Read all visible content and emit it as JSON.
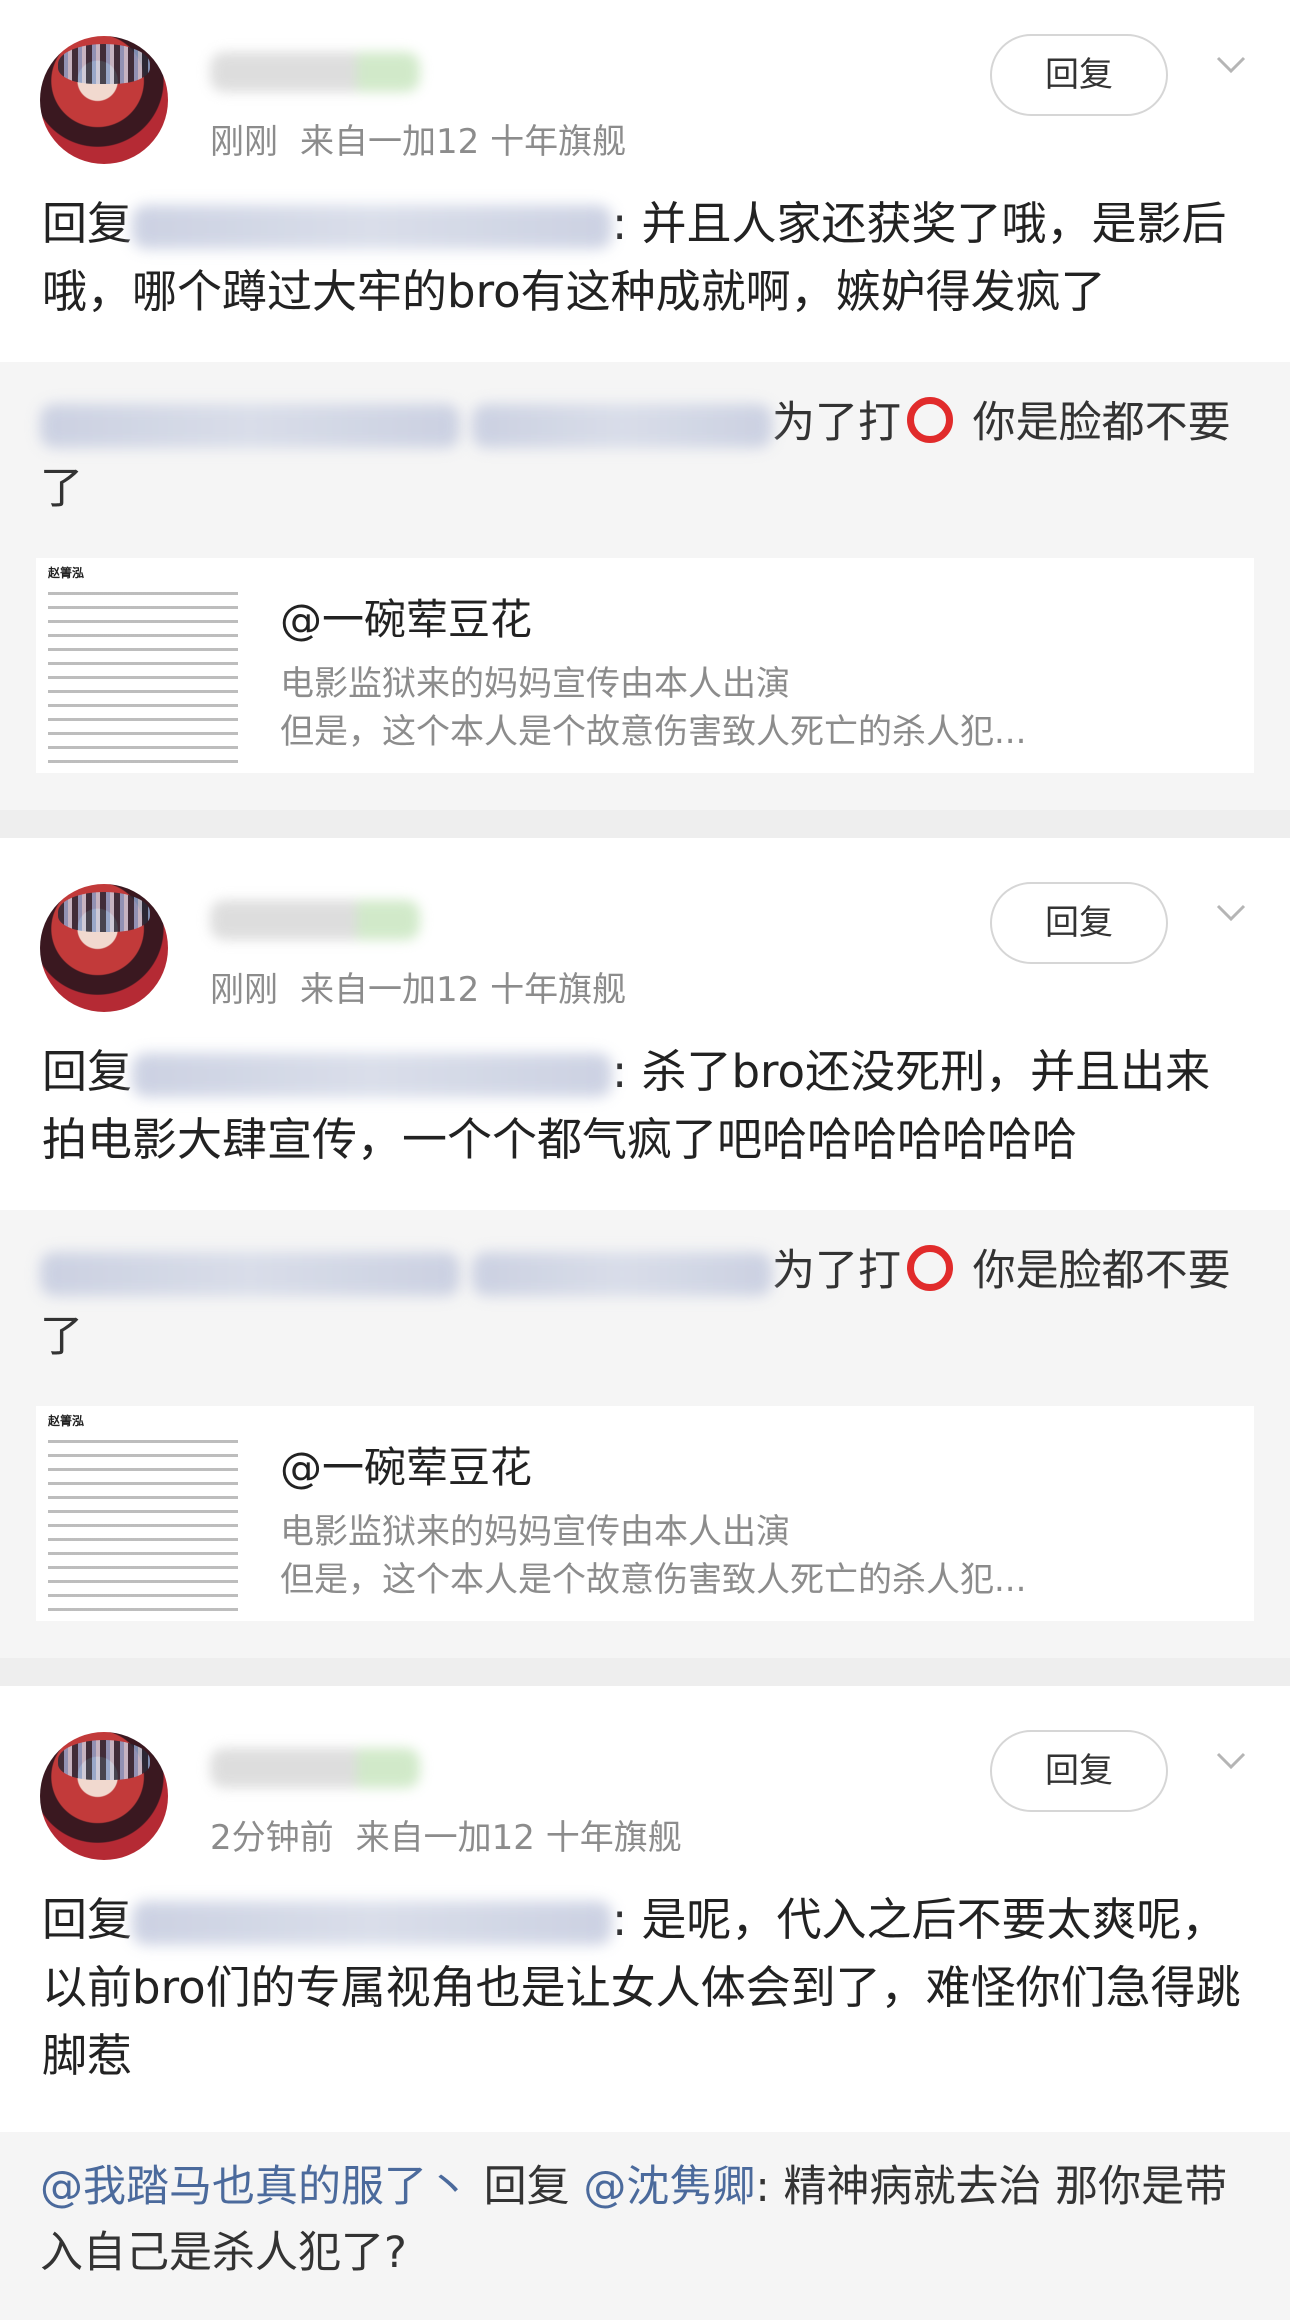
{
  "reply_button_label": "回复",
  "reply_prefix": "回复",
  "colors": {
    "link": "#4b6a9c",
    "meta": "#8c8c8c",
    "circle": "#e12b2b"
  },
  "comments": [
    {
      "time": "刚刚",
      "source": "来自一加12 十年旗舰",
      "text": ": 并且人家还获奖了哦，是影后哦，哪个蹲过大牢的bro有这种成就啊，嫉妒得发疯了",
      "quote": {
        "text_after": "为了打",
        "text_end": " 你是脸都不要了"
      },
      "card": {
        "thumb_title": "赵箐泓",
        "title": "@一碗荤豆花",
        "line1": "电影监狱来的妈妈宣传由本人出演",
        "line2": "但是，这个本人是个故意伤害致人死亡的杀人犯..."
      }
    },
    {
      "time": "刚刚",
      "source": "来自一加12 十年旗舰",
      "text": ": 杀了bro还没死刑，并且出来拍电影大肆宣传，一个个都气疯了吧哈哈哈哈哈哈哈",
      "quote": {
        "text_after": "为了打",
        "text_end": " 你是脸都不要了"
      },
      "card": {
        "thumb_title": "赵箐泓",
        "title": "@一碗荤豆花",
        "line1": "电影监狱来的妈妈宣传由本人出演",
        "line2": "但是，这个本人是个故意伤害致人死亡的杀人犯..."
      }
    },
    {
      "time": "2分钟前",
      "source": "来自一加12 十年旗舰",
      "text": ": 是呢，代入之后不要太爽呢，以前bro们的专属视角也是让女人体会到了，难怪你们急得跳脚惹",
      "quote": {
        "user": "@我踏马也真的服了丶",
        "reply_to": "@沈隽卿",
        "text": ": 精神病就去治 那你是带入自己是杀人犯了?"
      }
    }
  ]
}
